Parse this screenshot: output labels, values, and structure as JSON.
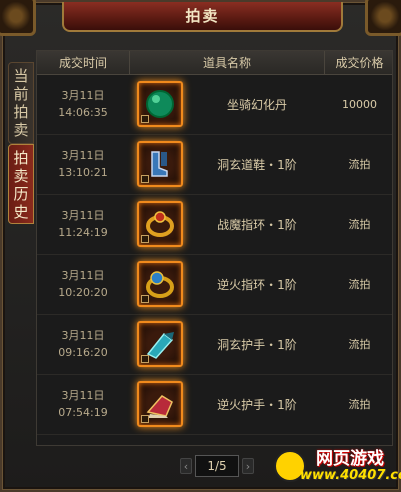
{
  "window": {
    "title": "拍卖"
  },
  "tabs": [
    {
      "label": "当前拍卖",
      "chars": [
        "当",
        "前",
        "拍",
        "卖"
      ]
    },
    {
      "label": "拍卖历史",
      "chars": [
        "拍",
        "卖",
        "历",
        "史"
      ]
    }
  ],
  "table": {
    "headers": [
      "成交时间",
      "道具名称",
      "成交价格"
    ],
    "rows": [
      {
        "date": "3月11日",
        "time": "14:06:35",
        "name": "坐骑幻化丹",
        "price": "10000",
        "icon": "green-orb-icon"
      },
      {
        "date": "3月11日",
        "time": "13:10:21",
        "name": "洞玄道鞋・1阶",
        "price": "流拍",
        "icon": "boots-icon"
      },
      {
        "date": "3月11日",
        "time": "11:24:19",
        "name": "战魔指环・1阶",
        "price": "流拍",
        "icon": "ring-icon"
      },
      {
        "date": "3月11日",
        "time": "10:20:20",
        "name": "逆火指环・1阶",
        "price": "流拍",
        "icon": "gem-ring-icon"
      },
      {
        "date": "3月11日",
        "time": "09:16:20",
        "name": "洞玄护手・1阶",
        "price": "流拍",
        "icon": "bracer-icon"
      },
      {
        "date": "3月11日",
        "time": "07:54:19",
        "name": "逆火护手・1阶",
        "price": "流拍",
        "icon": "gauntlet-icon"
      }
    ]
  },
  "pager": {
    "page": "1/5",
    "prev": "‹",
    "next": "›"
  },
  "watermark": {
    "title": "网页游戏",
    "url": "www.40407.com"
  },
  "colors": {
    "accent": "#f08a1c",
    "title_bg": "#8a2e22"
  }
}
